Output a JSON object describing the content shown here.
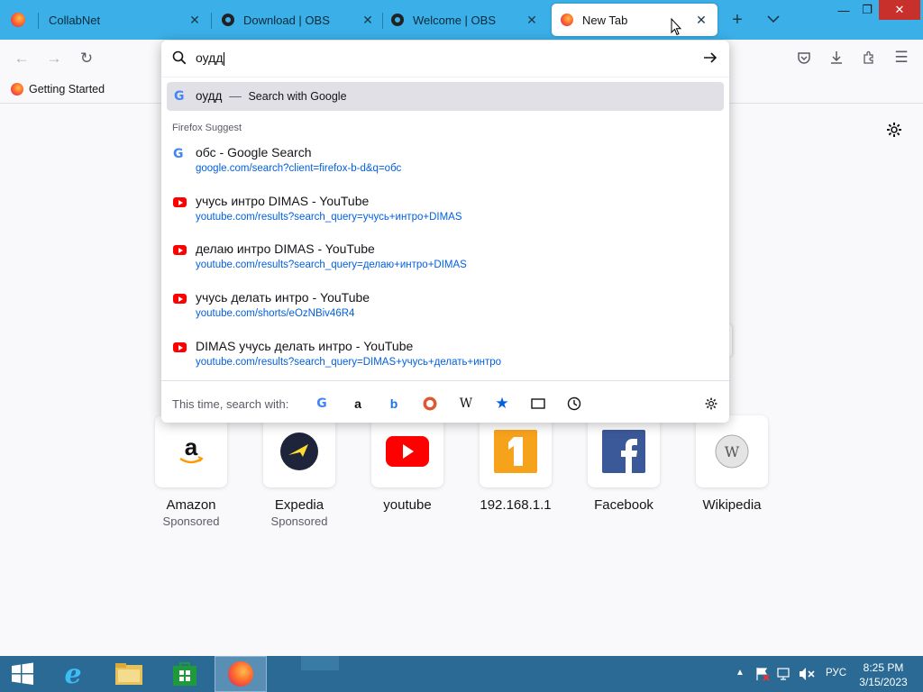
{
  "tabs": [
    {
      "title": "CollabNet",
      "icon": "firefox-icon"
    },
    {
      "title": "Download | OBS",
      "icon": "obs-icon"
    },
    {
      "title": "Welcome | OBS",
      "icon": "obs-icon"
    },
    {
      "title": "New Tab",
      "icon": "firefox-icon",
      "active": true
    }
  ],
  "toolbar": {
    "back_icon": "←",
    "forward_icon": "→",
    "reload_icon": "↻",
    "pocket_icon": "pocket-icon",
    "downloads_icon": "download-icon",
    "extensions_icon": "extensions-icon",
    "menu_icon": "☰"
  },
  "bookmarks": {
    "item_label": "Getting Started"
  },
  "urlbar": {
    "value": "оудд",
    "first_row": {
      "query": "оудд",
      "sep": "—",
      "label": "Search with Google"
    },
    "suggest_heading": "Firefox Suggest",
    "suggestions": [
      {
        "icon": "google-icon",
        "title": "обс - Google Search",
        "url": "google.com/search?client=firefox-b-d&q=обс"
      },
      {
        "icon": "youtube-icon",
        "title": "учусь интро DIMAS - YouTube",
        "url": "youtube.com/results?search_query=учусь+интро+DIMAS"
      },
      {
        "icon": "youtube-icon",
        "title": "делаю интро DIMAS - YouTube",
        "url": "youtube.com/results?search_query=делаю+интро+DIMAS"
      },
      {
        "icon": "youtube-icon",
        "title": "учусь делать интро - YouTube",
        "url": "youtube.com/shorts/eOzNBiv46R4"
      },
      {
        "icon": "youtube-icon",
        "title": "DIMAS учусь делать интро - YouTube",
        "url": "youtube.com/results?search_query=DIMAS+учусь+делать+интро"
      }
    ],
    "search_with_label": "This time, search with:",
    "engines": [
      "google-icon",
      "amazon-icon",
      "bing-icon",
      "duckduckgo-icon",
      "wikipedia-icon",
      "bookmarks-icon",
      "tabs-icon",
      "history-icon"
    ]
  },
  "top_sites": [
    {
      "name": "Amazon",
      "sponsored": "Sponsored"
    },
    {
      "name": "Expedia",
      "sponsored": "Sponsored"
    },
    {
      "name": "youtube"
    },
    {
      "name": "192.168.1.1"
    },
    {
      "name": "Facebook"
    },
    {
      "name": "Wikipedia"
    }
  ],
  "taskbar": {
    "tray_lang": "РУС",
    "time": "8:25 PM",
    "date": "3/15/2023"
  },
  "colors": {
    "tabstrip": "#3bb0e8",
    "taskbar": "#2a6a94",
    "link": "#0060df",
    "close": "#c7302b"
  }
}
